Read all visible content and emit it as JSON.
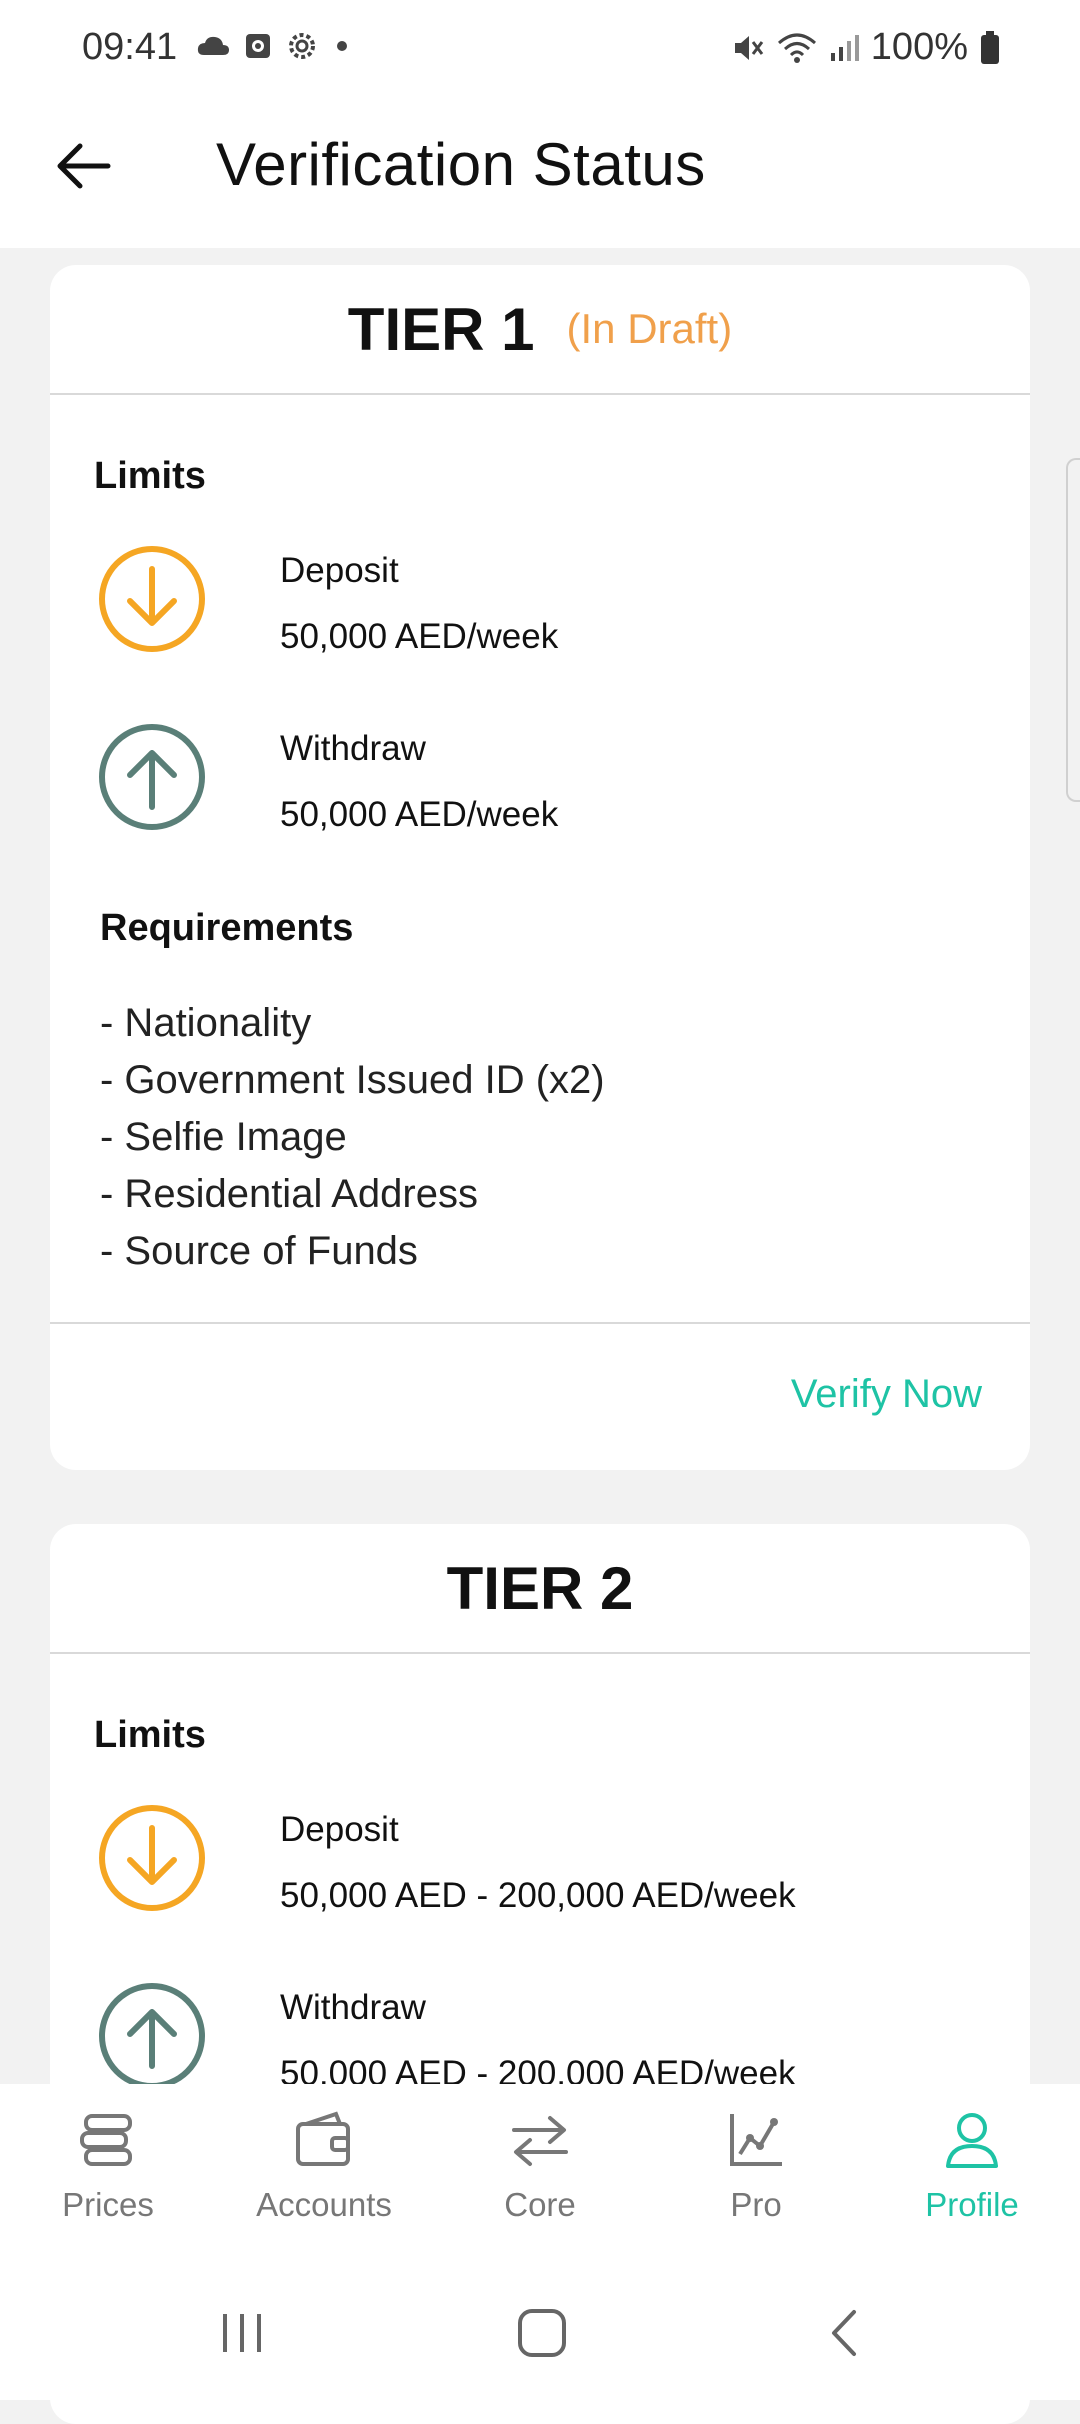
{
  "status_bar": {
    "time": "09:41",
    "battery": "100%",
    "icons": [
      "cloud-icon",
      "notification-icon",
      "settings-icon",
      "dot-icon",
      "mute-icon",
      "wifi-icon",
      "signal-icon",
      "battery-icon"
    ]
  },
  "header": {
    "title": "Verification Status",
    "back_icon": "arrow-left-icon"
  },
  "tiers": [
    {
      "title": "TIER 1",
      "status": "(In Draft)",
      "limits_label": "Limits",
      "deposit_label": "Deposit",
      "deposit_value": "50,000 AED/week",
      "withdraw_label": "Withdraw",
      "withdraw_value": "50,000 AED/week",
      "requirements_label": "Requirements",
      "requirements": [
        "- Nationality",
        "- Government Issued ID (x2)",
        "- Selfie Image",
        "- Residential Address",
        "- Source of Funds"
      ],
      "action": "Verify Now"
    },
    {
      "title": "TIER 2",
      "limits_label": "Limits",
      "deposit_label": "Deposit",
      "deposit_value": "50,000 AED - 200,000 AED/week",
      "withdraw_label": "Withdraw",
      "withdraw_value": "50,000 AED - 200,000 AED/week"
    }
  ],
  "bottom_nav": {
    "items": [
      {
        "label": "Prices",
        "icon": "stack-icon"
      },
      {
        "label": "Accounts",
        "icon": "wallet-icon"
      },
      {
        "label": "Core",
        "icon": "swap-icon"
      },
      {
        "label": "Pro",
        "icon": "chart-icon"
      },
      {
        "label": "Profile",
        "icon": "user-icon"
      }
    ],
    "active": "Profile"
  },
  "colors": {
    "accent": "#1ec3a5",
    "deposit": "#f5a623",
    "withdraw": "#5a7f78",
    "draft": "#f0a04b",
    "background": "#f2f2f2"
  }
}
